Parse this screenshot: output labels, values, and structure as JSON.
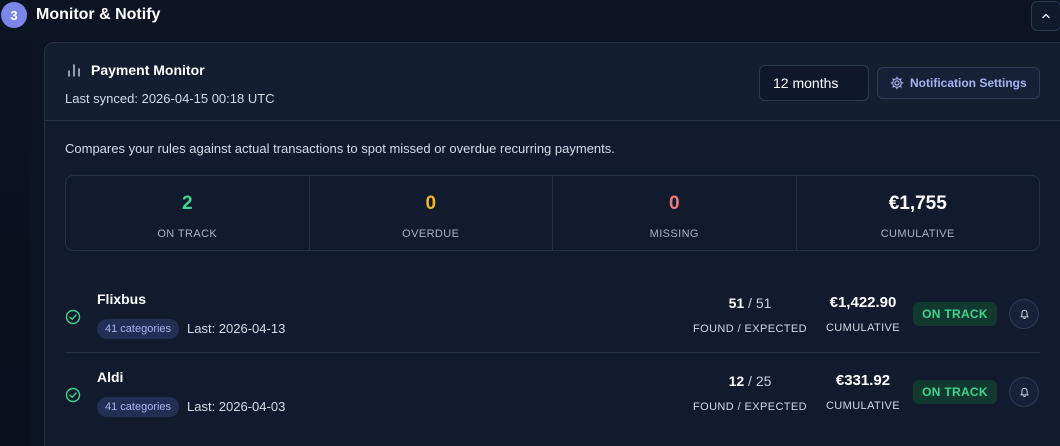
{
  "section": {
    "step": "3",
    "title": "Monitor & Notify"
  },
  "monitor": {
    "title": "Payment Monitor",
    "last_synced": "Last synced: 2026-04-15 00:18 UTC",
    "period": "12 months",
    "notification_button": "Notification Settings",
    "description": "Compares your rules against actual transactions to spot missed or overdue recurring payments."
  },
  "stats": [
    {
      "value": "2",
      "label": "ON TRACK",
      "color": "#3fd58f"
    },
    {
      "value": "0",
      "label": "OVERDUE",
      "color": "#f0b429"
    },
    {
      "value": "0",
      "label": "MISSING",
      "color": "#f07878"
    },
    {
      "value": "€1,755",
      "label": "CUMULATIVE",
      "color": "#ffffff"
    }
  ],
  "rows": [
    {
      "name": "Flixbus",
      "categories": "41 categories",
      "last": "Last: 2026-04-13",
      "found": "51",
      "expected": "/ 51",
      "found_label": "FOUND / EXPECTED",
      "cumulative": "€1,422.90",
      "cumulative_label": "CUMULATIVE",
      "status": "ON TRACK"
    },
    {
      "name": "Aldi",
      "categories": "41 categories",
      "last": "Last: 2026-04-03",
      "found": "12",
      "expected": "/ 25",
      "found_label": "FOUND / EXPECTED",
      "cumulative": "€331.92",
      "cumulative_label": "CUMULATIVE",
      "status": "ON TRACK"
    }
  ],
  "icons": {
    "collapse": "chevron-up-icon",
    "chart": "bar-chart-icon",
    "settings": "gear-icon",
    "check": "check-circle-icon",
    "bell": "bell-icon"
  }
}
